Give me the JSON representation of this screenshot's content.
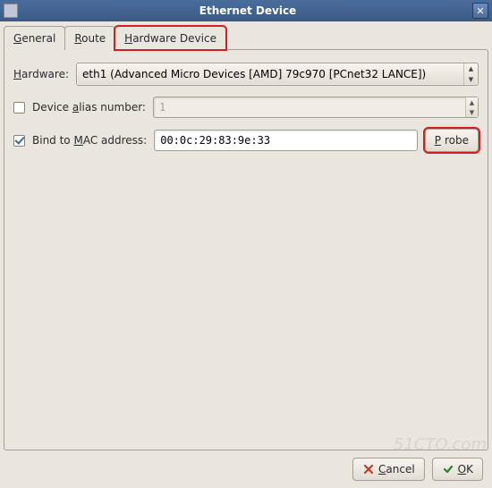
{
  "window": {
    "title": "Ethernet Device"
  },
  "tabs": {
    "general": "General",
    "route": "Route",
    "hardware": "Hardware Device"
  },
  "form": {
    "hardware_label": "Hardware:",
    "hardware_value": "eth1 (Advanced Micro Devices [AMD] 79c970 [PCnet32 LANCE])",
    "alias_label": "Device alias number:",
    "alias_value": "1",
    "alias_checked": false,
    "bind_label": "Bind to MAC address:",
    "bind_value": "00:0c:29:83:9e:33",
    "bind_checked": true,
    "probe_label": "Probe"
  },
  "footer": {
    "cancel": "Cancel",
    "ok": "OK"
  },
  "watermark": "51CTO.com"
}
